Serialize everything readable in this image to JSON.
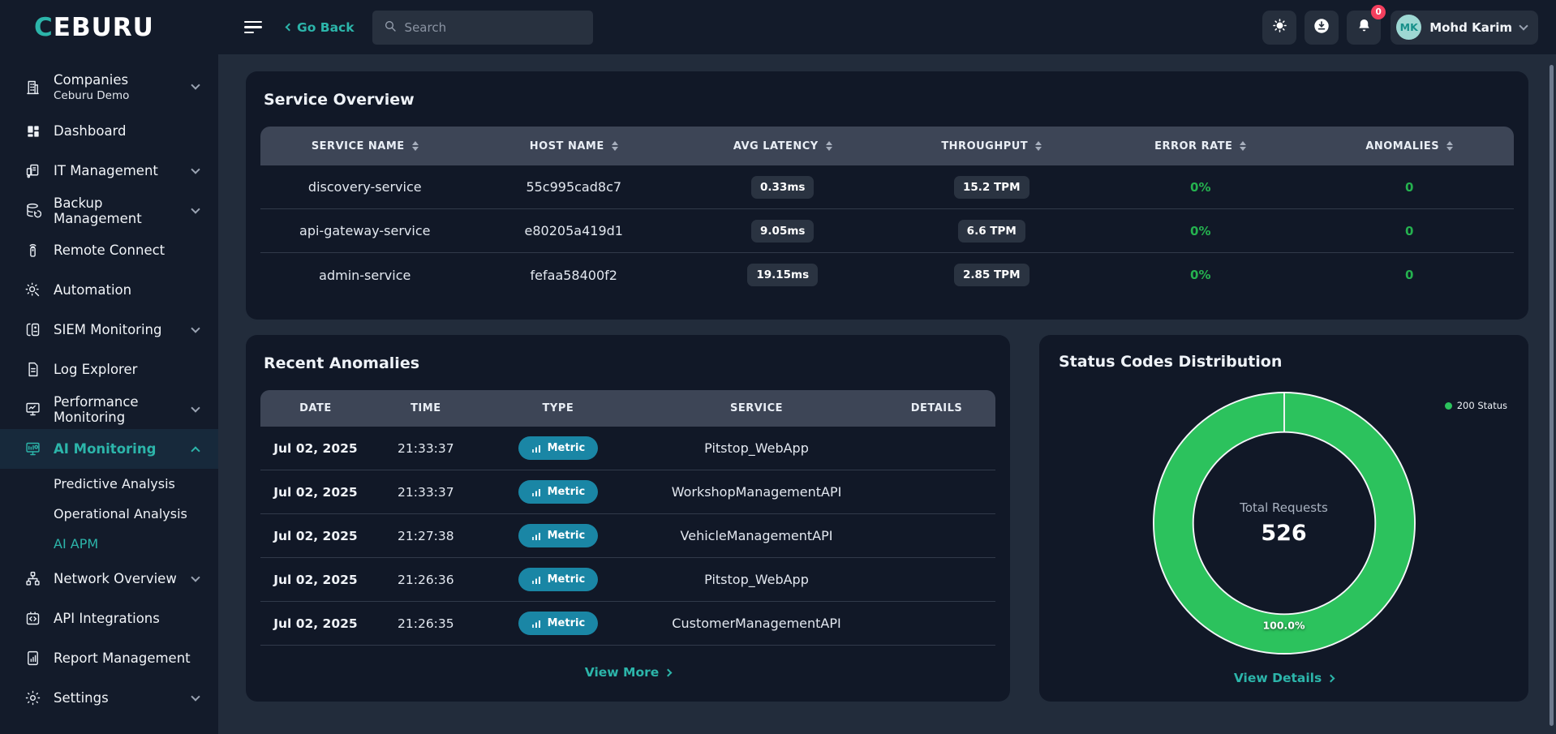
{
  "brand": {
    "logo_first_letter": "C",
    "logo_rest": "EBURU"
  },
  "header": {
    "go_back_label": "Go Back",
    "search": {
      "placeholder": "Search"
    },
    "notification_count": "0",
    "user": {
      "initials": "MK",
      "name": "Mohd Karim"
    }
  },
  "sidebar": {
    "items": [
      {
        "label": "Companies",
        "sublabel": "Ceburu Demo"
      },
      {
        "label": "Dashboard"
      },
      {
        "label": "IT Management"
      },
      {
        "label": "Backup Management"
      },
      {
        "label": "Remote Connect"
      },
      {
        "label": "Automation"
      },
      {
        "label": "SIEM Monitoring"
      },
      {
        "label": "Log Explorer"
      },
      {
        "label": "Performance Monitoring"
      },
      {
        "label": "AI Monitoring"
      },
      {
        "label": "Predictive Analysis"
      },
      {
        "label": "Operational Analysis"
      },
      {
        "label": "AI APM"
      },
      {
        "label": "Network Overview"
      },
      {
        "label": "API Integrations"
      },
      {
        "label": "Report Management"
      },
      {
        "label": "Settings"
      }
    ]
  },
  "service_overview": {
    "title": "Service Overview",
    "columns": [
      "SERVICE NAME",
      "HOST NAME",
      "AVG LATENCY",
      "THROUGHPUT",
      "ERROR RATE",
      "ANOMALIES"
    ],
    "rows": [
      {
        "service": "discovery-service",
        "host": "55c995cad8c7",
        "latency": "0.33ms",
        "throughput": "15.2 TPM",
        "error_rate": "0%",
        "anomalies": "0"
      },
      {
        "service": "api-gateway-service",
        "host": "e80205a419d1",
        "latency": "9.05ms",
        "throughput": "6.6 TPM",
        "error_rate": "0%",
        "anomalies": "0"
      },
      {
        "service": "admin-service",
        "host": "fefaa58400f2",
        "latency": "19.15ms",
        "throughput": "2.85 TPM",
        "error_rate": "0%",
        "anomalies": "0"
      }
    ]
  },
  "recent_anomalies": {
    "title": "Recent Anomalies",
    "columns": [
      "DATE",
      "TIME",
      "TYPE",
      "SERVICE",
      "DETAILS"
    ],
    "rows": [
      {
        "date": "Jul 02, 2025",
        "time": "21:33:37",
        "type": "Metric",
        "service": "Pitstop_WebApp",
        "details": ""
      },
      {
        "date": "Jul 02, 2025",
        "time": "21:33:37",
        "type": "Metric",
        "service": "WorkshopManagementAPI",
        "details": ""
      },
      {
        "date": "Jul 02, 2025",
        "time": "21:27:38",
        "type": "Metric",
        "service": "VehicleManagementAPI",
        "details": ""
      },
      {
        "date": "Jul 02, 2025",
        "time": "21:26:36",
        "type": "Metric",
        "service": "Pitstop_WebApp",
        "details": ""
      },
      {
        "date": "Jul 02, 2025",
        "time": "21:26:35",
        "type": "Metric",
        "service": "CustomerManagementAPI",
        "details": ""
      }
    ],
    "view_more_label": "View More"
  },
  "status_codes": {
    "title": "Status Codes Distribution",
    "legend_label": "200 Status",
    "center_label": "Total Requests",
    "center_value": "526",
    "slice_percent_label": "100.0%",
    "view_details_label": "View Details",
    "chart_data": {
      "type": "pie",
      "title": "Status Codes Distribution",
      "labels": [
        "200 Status"
      ],
      "values": [
        526
      ],
      "percentages": [
        100.0
      ],
      "total_label": "Total Requests",
      "total_value": 526,
      "colors": [
        "#2cc25d"
      ],
      "legend_position": "top-right",
      "donut": true
    }
  },
  "colors": {
    "accent_teal": "#2cb5aa",
    "success_green": "#25b14f",
    "donut_green": "#2cc25d",
    "metric_badge_teal": "#1a86a5",
    "notification_red": "#f43f5e",
    "chrome_bg": "#131b2a",
    "main_bg": "#222c3b",
    "card_bg": "#111827",
    "table_header_bg": "#3d4556"
  }
}
